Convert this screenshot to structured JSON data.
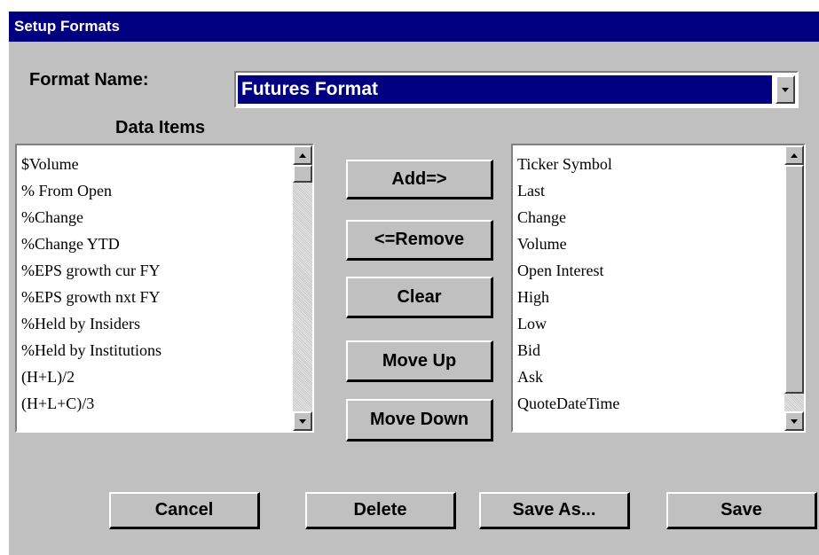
{
  "window": {
    "title": "Setup Formats"
  },
  "format_name": {
    "label": "Format Name:",
    "selected": "Futures Format",
    "dropdown_icon": "chevron-down-icon"
  },
  "data_items": {
    "label": "Data Items",
    "items": [
      "$Volume",
      "% From Open",
      "%Change",
      "%Change YTD",
      "%EPS growth cur FY",
      "%EPS growth nxt FY",
      "%Held by Insiders",
      "%Held by Institutions",
      "(H+L)/2",
      "(H+L+C)/3"
    ]
  },
  "selected_items": {
    "items": [
      "Ticker Symbol",
      "Last",
      "Change",
      "Volume",
      "Open Interest",
      "High",
      "Low",
      "Bid",
      "Ask",
      "QuoteDateTime"
    ]
  },
  "actions": {
    "add": "Add=>",
    "remove": "<=Remove",
    "clear": "Clear",
    "move_up": "Move Up",
    "move_down": "Move Down"
  },
  "footer": {
    "cancel": "Cancel",
    "delete": "Delete",
    "save_as": "Save As...",
    "save": "Save"
  },
  "colors": {
    "title_bar": "#000080",
    "face": "#c0c0c0",
    "selection": "#000080"
  }
}
